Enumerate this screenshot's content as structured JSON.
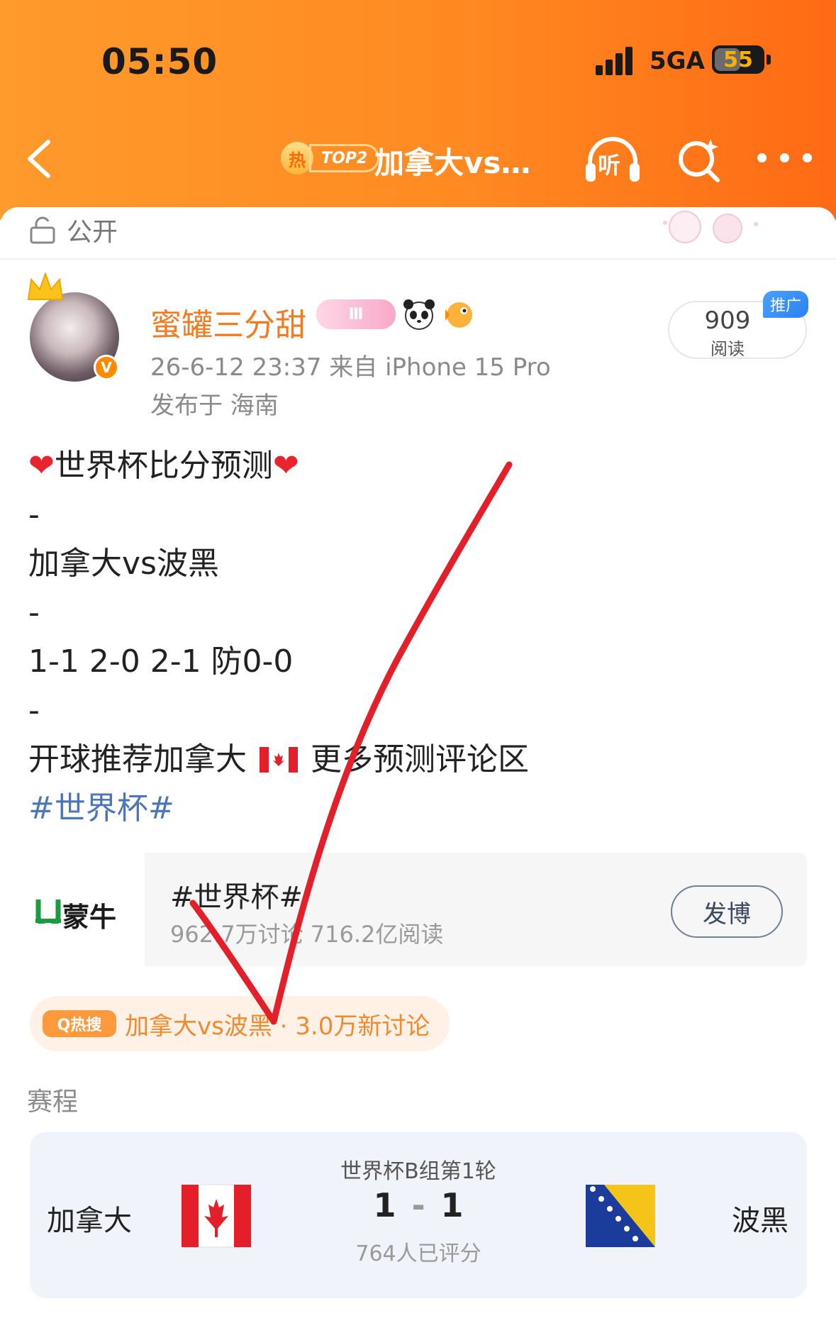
{
  "status_bar": {
    "time": "05:50",
    "network": "5GA",
    "battery_percent": 55
  },
  "nav": {
    "hot_badge_char": "热",
    "hot_rank": "TOP2",
    "title": "加拿大vs…",
    "listen_label": "听"
  },
  "post": {
    "visibility": "公开",
    "author": {
      "name": "蜜罐三分甜",
      "verified_mark": "V",
      "vip_badge": "Ⅲ"
    },
    "meta": "26-6-12 23:37  来自 iPhone 15 Pro",
    "location": "发布于 海南",
    "reads": {
      "count": "909",
      "label": "阅读",
      "promo": "推广"
    },
    "content": {
      "heart": "❤",
      "line1": "世界杯比分预测",
      "dash": "-",
      "line3": "加拿大vs波黑",
      "line5": "1-1  2-0   2-1  防0-0",
      "line7": "开球推荐加拿大",
      "line7b": "更多预测评论区",
      "hashtag": "#世界杯#"
    }
  },
  "topic_card": {
    "sponsor": "蒙牛",
    "title": "#世界杯#",
    "stats": "962.7万讨论   716.2亿阅读",
    "post_button": "发博"
  },
  "hot_search": {
    "badge": "Q热搜",
    "text": "加拿大vs波黑 · 3.0万新讨论"
  },
  "schedule": {
    "label": "赛程",
    "stage": "世界杯B组第1轮",
    "home_team": "加拿大",
    "away_team": "波黑",
    "home_score": "1",
    "away_score": "1",
    "score_separator": "-",
    "ratings": "764人已评分"
  },
  "colors": {
    "header_orange": "#ff8a22",
    "accent_name": "#f27b22",
    "hashtag_blue": "#4c76b8",
    "checkmark_red": "#e3202a"
  }
}
